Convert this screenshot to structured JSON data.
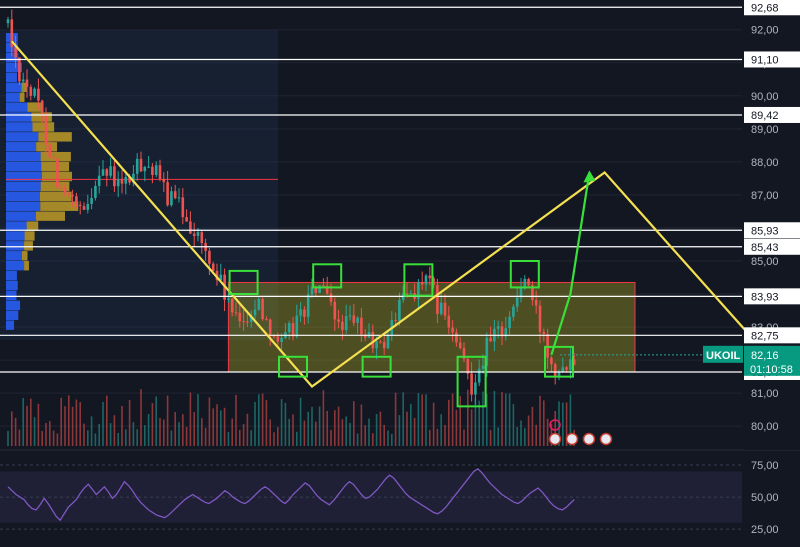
{
  "chart_data": {
    "type": "candlestick",
    "symbol": "UKOIL",
    "last_price": "82,16",
    "countdown": "01:10:58",
    "price_axis": {
      "range": [
        79.4,
        92.9
      ],
      "ticks": [
        "80,00",
        "81,00",
        "82,00",
        "83,00",
        "84,00",
        "85,00",
        "86,00",
        "87,00",
        "88,00",
        "89,00",
        "90,00",
        "91,00",
        "92,00"
      ]
    },
    "horizontal_levels": [
      {
        "value": 92.68,
        "label": "92,68"
      },
      {
        "value": 91.1,
        "label": "91,10"
      },
      {
        "value": 89.42,
        "label": "89,42"
      },
      {
        "value": 85.93,
        "label": "85,93"
      },
      {
        "value": 85.43,
        "label": "85,43"
      },
      {
        "value": 83.93,
        "label": "83,93"
      },
      {
        "value": 82.75,
        "label": "82,75"
      },
      {
        "value": 81.64,
        "label": "81,64"
      }
    ],
    "consolidation_range": {
      "low": 81.64,
      "high": 84.35,
      "bar_start": 58,
      "bar_end": 165
    },
    "poc_level": 87.47,
    "trend_path": [
      {
        "bar": 1,
        "price": 91.65
      },
      {
        "bar": 80,
        "price": 81.2
      },
      {
        "bar": 157,
        "price": 87.68
      },
      {
        "bar": 196,
        "price": 82.65
      }
    ],
    "projection_path": [
      {
        "bar": 143,
        "price": 82.16
      },
      {
        "bar": 148,
        "price": 84.0
      },
      {
        "bar": 153,
        "price": 87.68
      }
    ],
    "highlight_boxes": [
      {
        "bar": 62,
        "price_low": 84.0,
        "price_high": 84.7
      },
      {
        "bar": 84,
        "price_low": 84.2,
        "price_high": 84.9
      },
      {
        "bar": 108,
        "price_low": 83.95,
        "price_high": 84.9
      },
      {
        "bar": 136,
        "price_low": 84.2,
        "price_high": 85.0
      },
      {
        "bar": 75,
        "price_low": 81.5,
        "price_high": 82.1
      },
      {
        "bar": 97,
        "price_low": 81.5,
        "price_high": 82.1
      },
      {
        "bar": 122,
        "price_low": 80.6,
        "price_high": 82.1
      },
      {
        "bar": 145,
        "price_low": 81.5,
        "price_high": 82.4
      }
    ],
    "rsi": {
      "range": [
        15,
        82
      ],
      "ticks": [
        "75,00",
        "50,00",
        "25,00"
      ],
      "values": [
        58,
        55,
        52,
        50,
        48,
        44,
        41,
        40,
        44,
        49,
        45,
        40,
        35,
        32,
        37,
        42,
        45,
        48,
        53,
        57,
        60,
        56,
        52,
        55,
        58,
        54,
        49,
        52,
        57,
        62,
        59,
        55,
        50,
        46,
        43,
        40,
        38,
        36,
        35,
        34,
        36,
        39,
        42,
        45,
        48,
        50,
        52,
        50,
        48,
        46,
        45,
        47,
        49,
        52,
        55,
        53,
        50,
        48,
        46,
        45,
        47,
        50,
        53,
        56,
        58,
        56,
        53,
        50,
        47,
        45,
        48,
        52,
        55,
        58,
        61,
        59,
        55,
        51,
        48,
        46,
        44,
        47,
        51,
        55,
        59,
        62,
        60,
        56,
        52,
        49,
        50,
        53,
        56,
        60,
        64,
        67,
        65,
        61,
        57,
        53,
        50,
        48,
        46,
        44,
        42,
        40,
        38,
        37,
        39,
        42,
        46,
        50,
        54,
        58,
        62,
        66,
        70,
        72,
        69,
        65,
        61,
        58,
        55,
        52,
        50,
        48,
        46,
        45,
        47,
        50,
        53,
        55,
        57,
        54,
        50,
        46,
        43,
        41,
        40,
        42,
        45,
        48
      ]
    }
  }
}
